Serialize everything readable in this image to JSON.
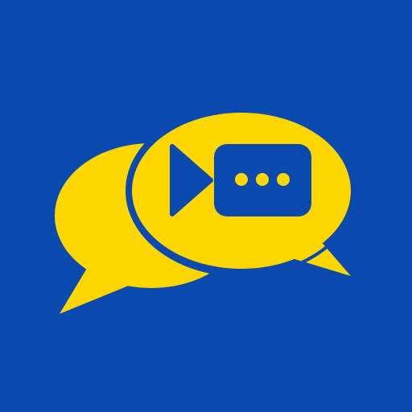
{
  "icon": {
    "name": "video-chat-app-icon",
    "colors": {
      "background": "#0A4AAE",
      "bubble": "#FFD700",
      "glyph": "#0A4AAE"
    },
    "glyphs": [
      "speech-bubble-back-icon",
      "speech-bubble-front-icon",
      "video-camera-icon",
      "typing-dots-icon"
    ]
  }
}
